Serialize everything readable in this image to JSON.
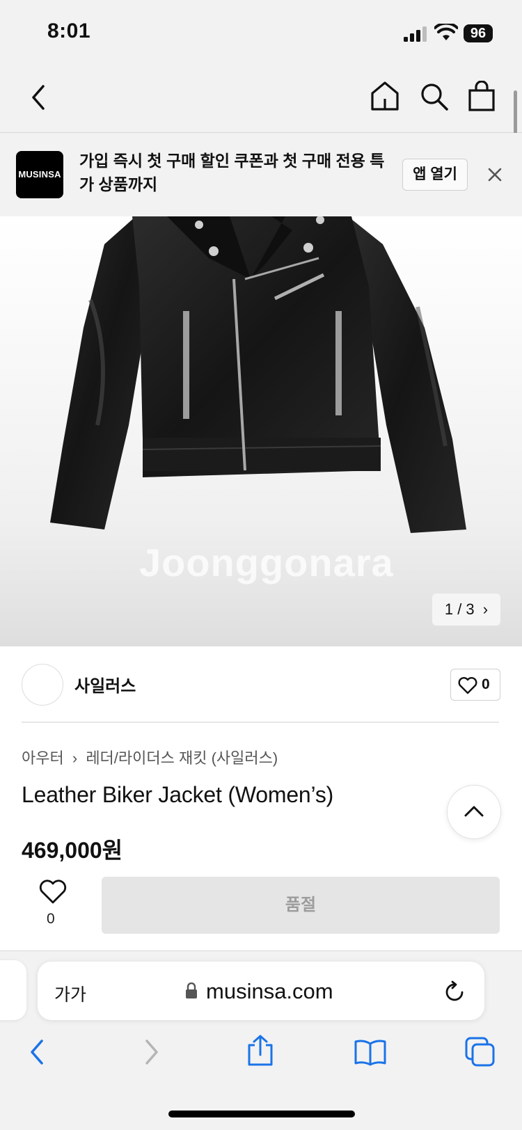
{
  "status": {
    "time": "8:01",
    "battery": "96"
  },
  "banner": {
    "logo": "MUSINSA",
    "text": "가입 즉시 첫 구매 할인 쿠폰과 첫 구매 전용 특가 상품까지",
    "open_app": "앱 열기"
  },
  "gallery": {
    "watermark": "Joonggonara",
    "counter": "1 / 3"
  },
  "seller": {
    "name": "사일러스",
    "likes": "0"
  },
  "product": {
    "breadcrumb_1": "아우터",
    "breadcrumb_2": "레더/라이더스 재킷 (사일러스)",
    "title": "Leather Biker Jacket (Women’s)",
    "price": "469,000원",
    "wish_count": "0",
    "soldout_label": "품절"
  },
  "browser": {
    "aa_label": "가가",
    "url": "musinsa.com"
  },
  "colors": {
    "ios_blue": "#1a73e8",
    "soldout_bg": "#e5e5e5"
  }
}
